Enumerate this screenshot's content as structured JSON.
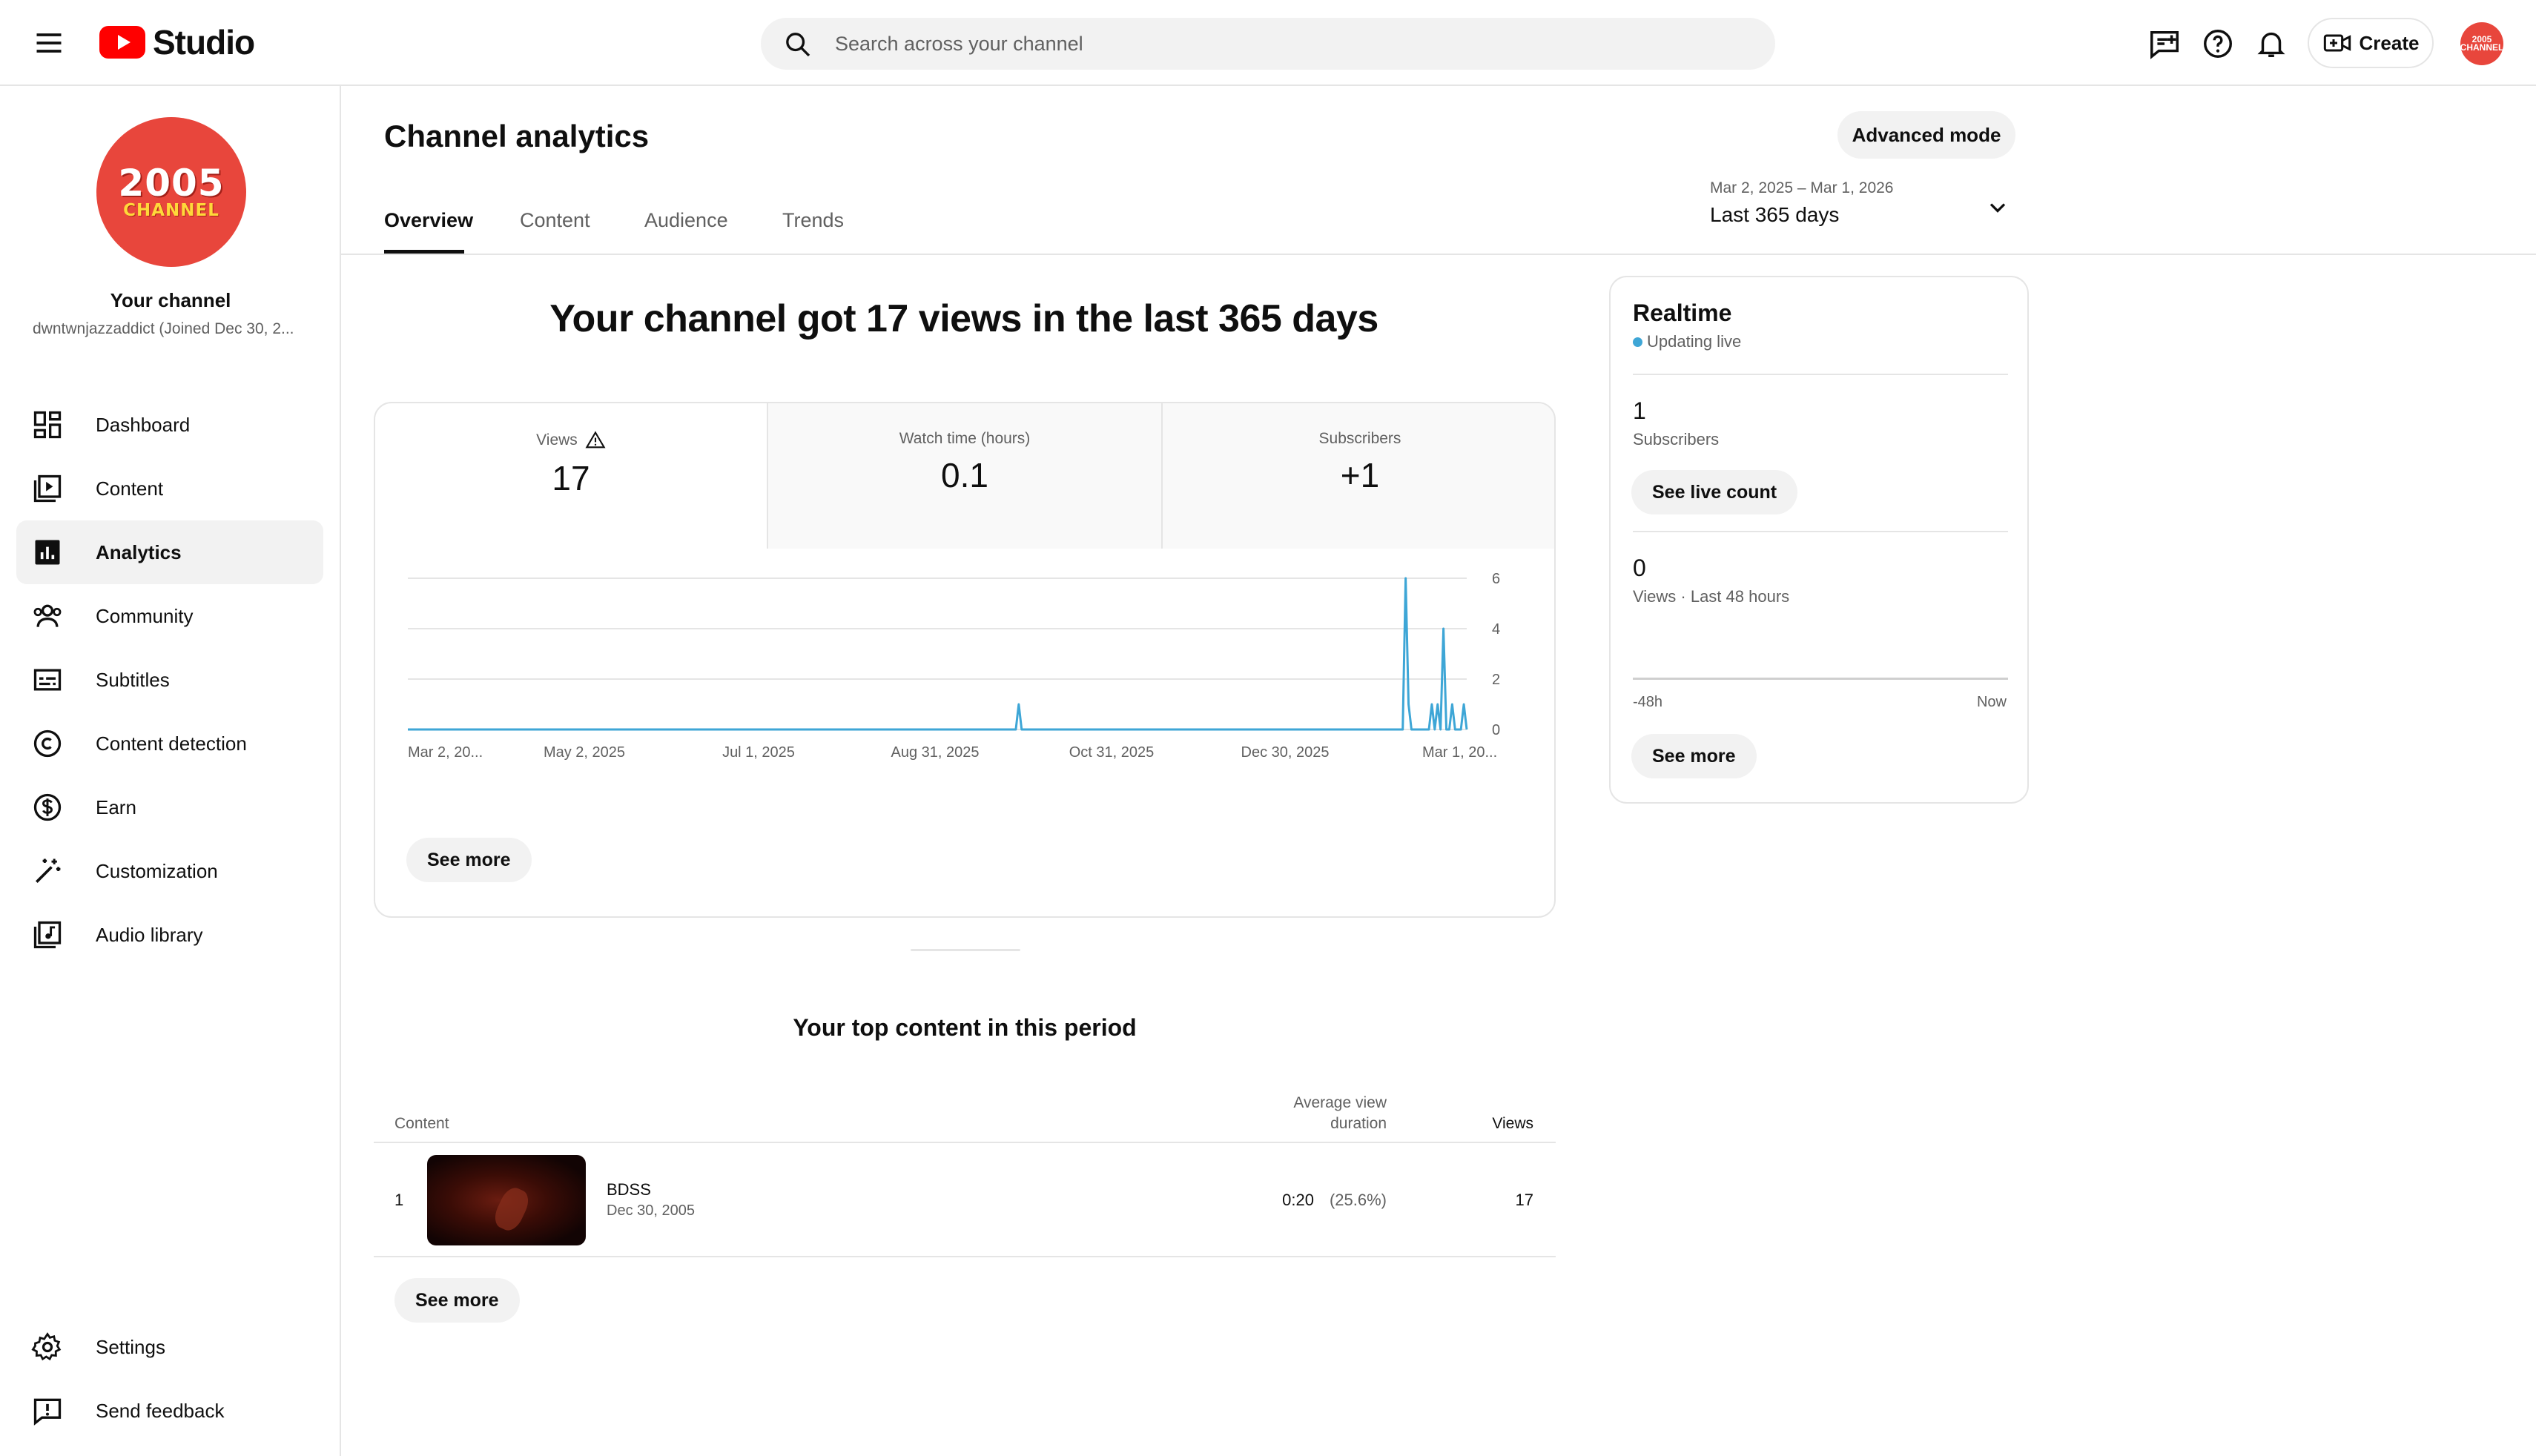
{
  "header": {
    "logo_text": "Studio",
    "search_placeholder": "Search across your channel",
    "create_label": "Create",
    "avatar_text": "2005 CHANNEL"
  },
  "sidebar": {
    "channel_avatar_line1": "2005",
    "channel_avatar_line2": "CHANNEL",
    "channel_title": "Your channel",
    "channel_handle": "dwntwnjazzaddict (Joined Dec 30, 2...",
    "items": [
      {
        "label": "Dashboard",
        "icon": "dashboard-icon"
      },
      {
        "label": "Content",
        "icon": "content-icon"
      },
      {
        "label": "Analytics",
        "icon": "analytics-icon",
        "active": true
      },
      {
        "label": "Community",
        "icon": "community-icon"
      },
      {
        "label": "Subtitles",
        "icon": "subtitles-icon"
      },
      {
        "label": "Content detection",
        "icon": "copyright-icon"
      },
      {
        "label": "Earn",
        "icon": "dollar-icon"
      },
      {
        "label": "Customization",
        "icon": "magic-wand-icon"
      },
      {
        "label": "Audio library",
        "icon": "audio-library-icon"
      }
    ],
    "bottom_items": [
      {
        "label": "Settings",
        "icon": "gear-icon"
      },
      {
        "label": "Send feedback",
        "icon": "feedback-icon"
      }
    ]
  },
  "main": {
    "title": "Channel analytics",
    "advanced_mode_label": "Advanced mode",
    "tabs": [
      {
        "label": "Overview",
        "active": true
      },
      {
        "label": "Content"
      },
      {
        "label": "Audience"
      },
      {
        "label": "Trends"
      }
    ],
    "date_range": "Mar 2, 2025 – Mar 1, 2026",
    "date_period": "Last 365 days",
    "headline": "Your channel got 17 views in the last 365 days",
    "metrics": [
      {
        "label": "Views",
        "value": "17",
        "warning": true
      },
      {
        "label": "Watch time (hours)",
        "value": "0.1"
      },
      {
        "label": "Subscribers",
        "value": "+1"
      }
    ],
    "see_more_label": "See more",
    "top_content": {
      "title": "Your top content in this period",
      "col_content": "Content",
      "col_avd_line1": "Average view",
      "col_avd_line2": "duration",
      "col_views": "Views",
      "rows": [
        {
          "rank": "1",
          "title": "BDSS",
          "date": "Dec 30, 2005",
          "avd": "0:20",
          "avd_pct": "(25.6%)",
          "views": "17"
        }
      ],
      "see_more_label": "See more"
    }
  },
  "realtime": {
    "title": "Realtime",
    "status": "Updating live",
    "subscribers_value": "1",
    "subscribers_label": "Subscribers",
    "see_live_count_label": "See live count",
    "views_value": "0",
    "views_label": "Views · Last 48 hours",
    "axis_start": "-48h",
    "axis_end": "Now",
    "see_more_label": "See more"
  },
  "colors": {
    "accent_line": "#3ea6d6",
    "brand_red": "#ff0000",
    "avatar_red": "#e8463c"
  },
  "chart_data": {
    "type": "line",
    "series": [
      {
        "x": [
          "2025-03-02",
          "2025-09-27",
          "2025-09-28",
          "2025-09-29",
          "2026-02-07",
          "2026-02-08",
          "2026-02-09",
          "2026-02-10",
          "2026-02-11",
          "2026-02-12",
          "2026-02-16",
          "2026-02-17",
          "2026-02-18",
          "2026-02-19",
          "2026-02-20",
          "2026-02-21",
          "2026-02-22",
          "2026-02-23",
          "2026-02-24",
          "2026-02-25",
          "2026-02-26",
          "2026-02-27",
          "2026-02-28",
          "2026-03-01"
        ],
        "values": [
          0,
          0,
          1,
          0,
          0,
          6,
          1,
          0,
          0,
          0,
          0,
          1,
          0,
          1,
          0,
          4,
          0,
          0,
          1,
          0,
          0,
          0,
          1,
          0
        ]
      }
    ],
    "x_tick_labels": [
      "Mar 2, 20...",
      "May 2, 2025",
      "Jul 1, 2025",
      "Aug 31, 2025",
      "Oct 31, 2025",
      "Dec 30, 2025",
      "Mar 1, 20..."
    ],
    "y_ticks": [
      0,
      2,
      4,
      6
    ],
    "ylim": [
      0,
      6
    ],
    "grid": true
  }
}
